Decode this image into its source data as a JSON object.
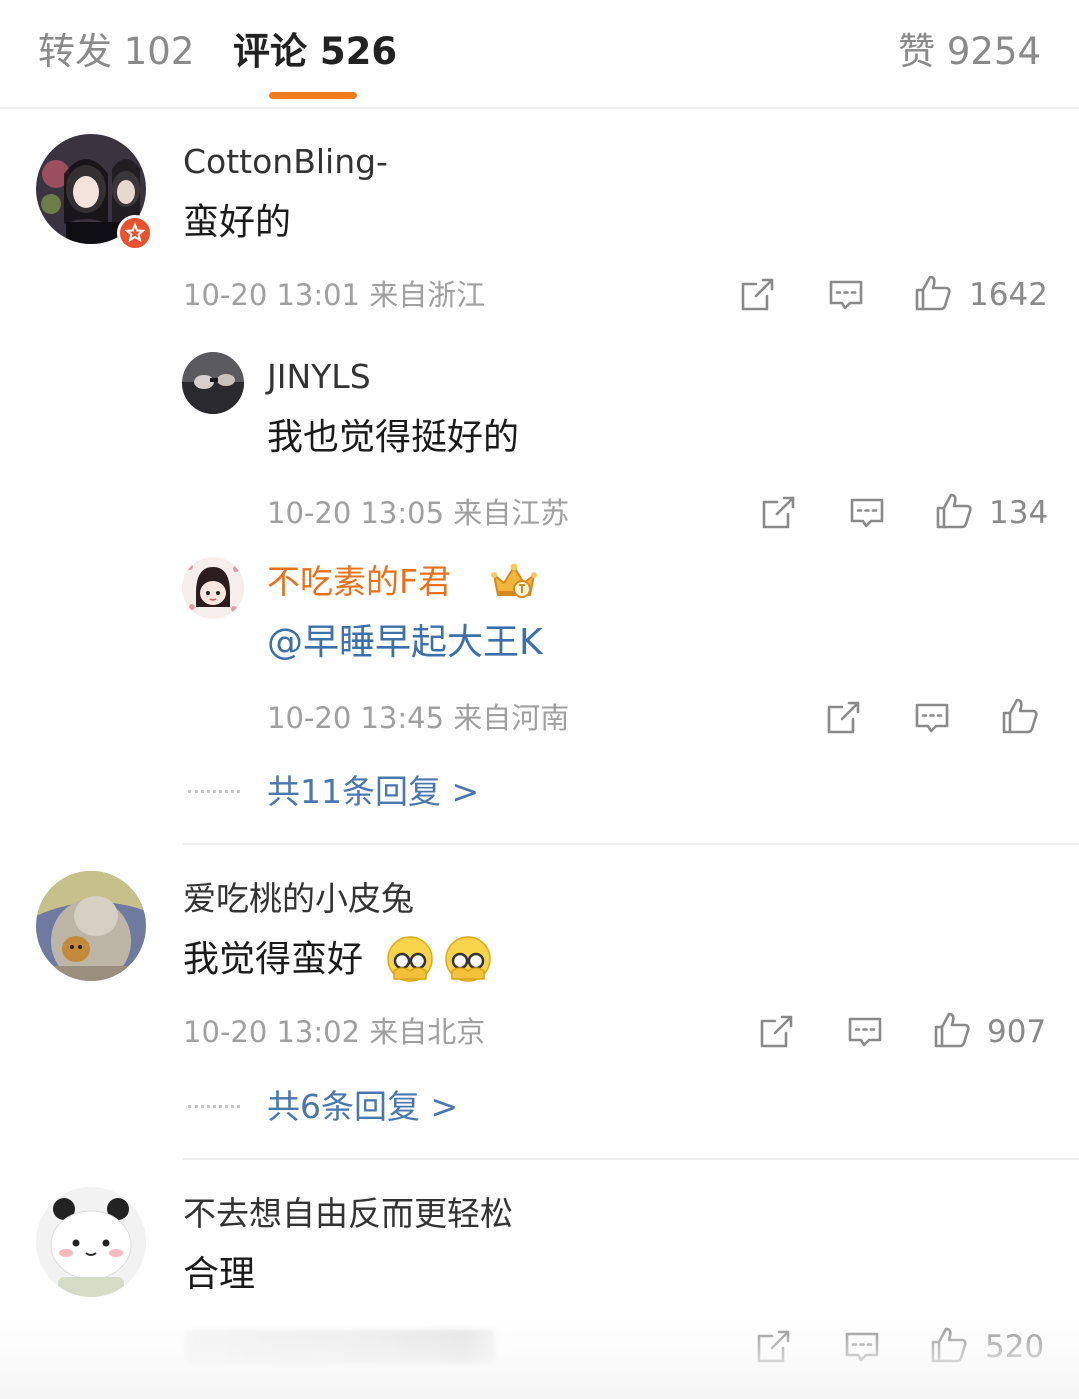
{
  "tabs": {
    "repost": "转发 102",
    "comments": "评论 526",
    "likes": "赞 9254"
  },
  "colors": {
    "accent": "#f07c1d",
    "link": "#3d6fa8",
    "vip_name": "#e8711c"
  },
  "comments": [
    {
      "user": "CottonBling-",
      "text": "蛮好的",
      "meta": "10-20 13:01 来自浙江",
      "likes": "1642",
      "replies": [
        {
          "user": "JINYLS",
          "text": "我也觉得挺好的",
          "meta": "10-20 13:05 来自江苏",
          "likes": "134"
        },
        {
          "user": "不吃素的F君",
          "badge_icon": "crown-vip-icon",
          "text": "@早睡早起大王K",
          "meta": "10-20 13:45 来自河南",
          "likes": ""
        }
      ],
      "more_replies": "共11条回复 >"
    },
    {
      "user": "爱吃桃的小皮兔",
      "text": "我觉得蛮好",
      "emoji_icons": [
        "facepalm-emoji-icon",
        "facepalm-emoji-icon"
      ],
      "meta": "10-20 13:02 来自北京",
      "likes": "907",
      "more_replies": "共6条回复 >"
    },
    {
      "user": "不去想自由反而更轻松",
      "text": "合理",
      "likes": "520"
    }
  ],
  "icons": {
    "share": "share-icon",
    "reply": "comment-icon",
    "like": "thumbs-up-icon"
  }
}
